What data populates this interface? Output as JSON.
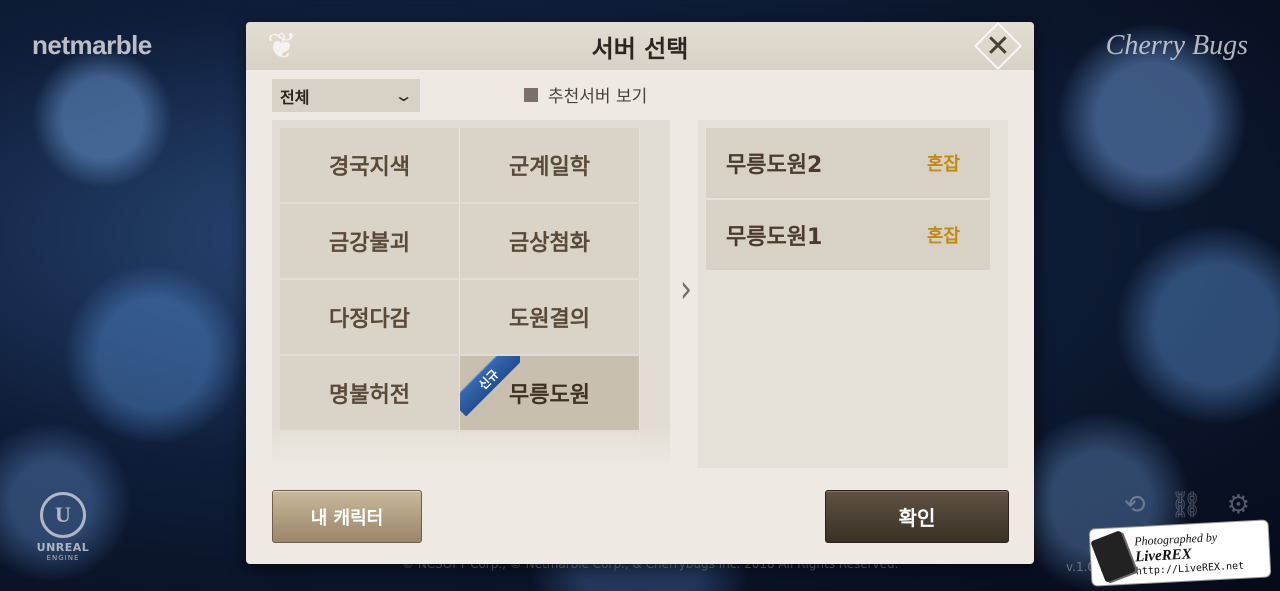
{
  "background": {
    "brand_left": "netmarble",
    "brand_right": "Cherry Bugs",
    "engine_word": "UNREAL",
    "engine_sub": "ENGINE",
    "engine_mark": "U",
    "copyright": "© NCSOFT Corp., © Netmarble Corp., & Cherrybugs Inc. 2018 All Rights Reserved.",
    "version": "v.1.0"
  },
  "dialog": {
    "title": "서버 선택",
    "close_label": "✕",
    "filter": {
      "selected": "전체"
    },
    "recommend_toggle_label": "추천서버 보기",
    "servers": [
      {
        "label": "경국지색",
        "selected": false,
        "new_badge": ""
      },
      {
        "label": "군계일학",
        "selected": false,
        "new_badge": ""
      },
      {
        "label": "금강불괴",
        "selected": false,
        "new_badge": ""
      },
      {
        "label": "금상첨화",
        "selected": false,
        "new_badge": ""
      },
      {
        "label": "다정다감",
        "selected": false,
        "new_badge": ""
      },
      {
        "label": "도원결의",
        "selected": false,
        "new_badge": ""
      },
      {
        "label": "명불허전",
        "selected": false,
        "new_badge": ""
      },
      {
        "label": "무릉도원",
        "selected": true,
        "new_badge": "신규"
      }
    ],
    "channels": [
      {
        "name": "무릉도원2",
        "status": "혼잡"
      },
      {
        "name": "무릉도원1",
        "status": "혼잡"
      }
    ],
    "my_character_button": "내 캐릭터",
    "confirm_button": "확인"
  },
  "watermark": {
    "line1_prefix": "Photographed by",
    "line1_name": "LiveREX",
    "line2": "http://LiveREX.net"
  },
  "colors": {
    "status_busy": "#c48a0a",
    "new_ribbon": "#2f5fa6",
    "dialog_bg": "#eeeae3"
  }
}
